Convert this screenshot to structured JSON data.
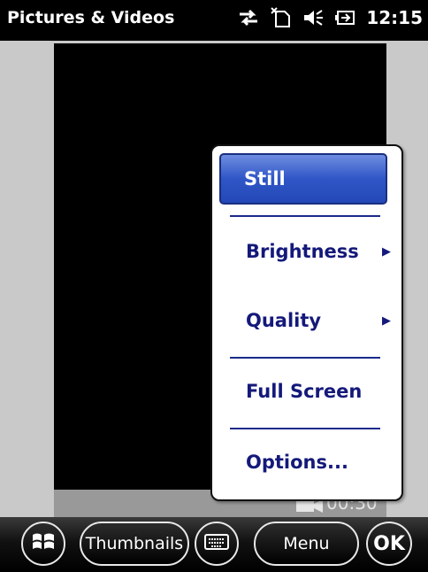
{
  "status_bar": {
    "title": "Pictures & Videos",
    "time": "12:15",
    "icons": [
      "sync-arrows-icon",
      "no-sim-icon",
      "speaker-muted-icon",
      "battery-charging-icon"
    ]
  },
  "viewer": {
    "timer": "00:30",
    "camera_icon": "video-camera-icon"
  },
  "menu": {
    "items": [
      {
        "label": "Still",
        "selected": true,
        "submenu": false
      },
      {
        "label": "Brightness",
        "selected": false,
        "submenu": true
      },
      {
        "label": "Quality",
        "selected": false,
        "submenu": true
      },
      {
        "label": "Full Screen",
        "selected": false,
        "submenu": false
      },
      {
        "label": "Options...",
        "selected": false,
        "submenu": false
      }
    ]
  },
  "taskbar": {
    "start_icon": "windows-logo-icon",
    "thumbnails_label": "Thumbnails",
    "keyboard_icon": "keyboard-icon",
    "menu_label": "Menu",
    "ok_label": "OK"
  },
  "colors": {
    "menu_text": "#14197a",
    "selection": "#2f56c7",
    "status_bar": "#000000"
  }
}
